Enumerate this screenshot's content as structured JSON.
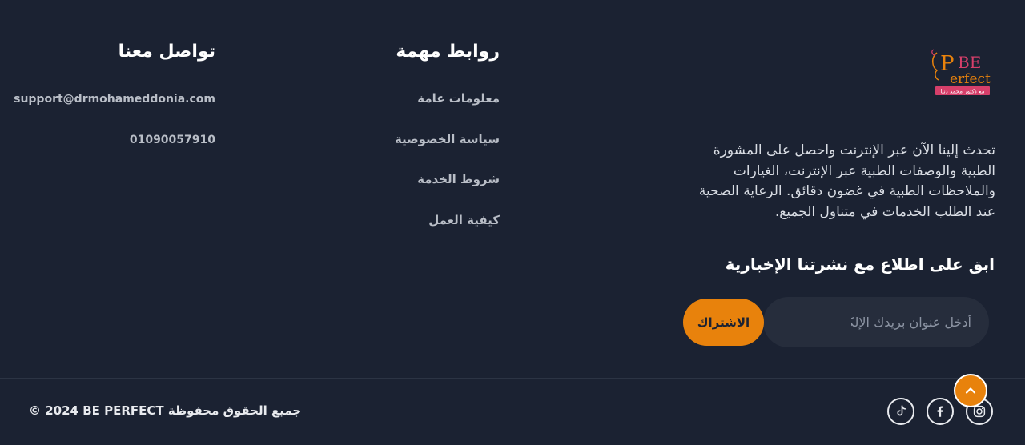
{
  "brand": {
    "logo_text_top": "BE",
    "logo_text_bottom": "erfect",
    "logo_letters": "P",
    "logo_subtitle": "مع دكتور محمد دنيا",
    "about_text": "تحدث إلينا الآن عبر الإنترنت واحصل على المشورة الطبية والوصفات الطبية عبر الإنترنت، الغيارات والملاحظات الطبية في غضون دقائق. الرعاية الصحية عند الطلب الخدمات في متناول الجميع."
  },
  "newsletter": {
    "title": "ابق على اطلاع مع نشرتنا الإخبارية",
    "email_placeholder": "أدخل عنوان بريدك الإلكتروني",
    "subscribe_label": "الاشتراك"
  },
  "important_links": {
    "title": "روابط مهمة",
    "items": [
      {
        "label": "معلومات عامة"
      },
      {
        "label": "سياسة الخصوصية"
      },
      {
        "label": "شروط الخدمة"
      },
      {
        "label": "كيفية العمل"
      }
    ]
  },
  "contact": {
    "title": "تواصل معنا",
    "email": "support@drmohameddonia.com",
    "phone": "01090057910"
  },
  "footer": {
    "copyright": "© 2024 BE PERFECT جميع الحقوق محفوظة"
  },
  "social": {
    "icons": [
      "tiktok-icon",
      "facebook-icon",
      "instagram-icon"
    ]
  },
  "colors": {
    "background": "#1b2232",
    "accent": "#e8820c",
    "input_bg": "#262d3c",
    "logo_pink": "#d63f6a"
  }
}
